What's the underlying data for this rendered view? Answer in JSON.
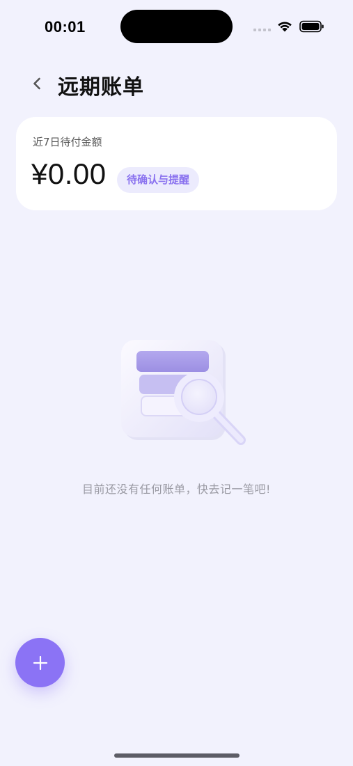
{
  "status_bar": {
    "time": "00:01"
  },
  "header": {
    "title": "远期账单"
  },
  "summary_card": {
    "label": "近7日待付金额",
    "amount": "¥0.00",
    "pill_label": "待确认与提醒"
  },
  "empty_state": {
    "illustration_icon": "document-search-icon",
    "message": "目前还没有任何账单，快去记一笔吧!"
  },
  "fab": {
    "icon": "plus-icon"
  },
  "colors": {
    "background": "#f2f2fd",
    "accent": "#8b73f5",
    "pill_bg": "#ecebfd",
    "pill_text": "#8a72ef"
  }
}
